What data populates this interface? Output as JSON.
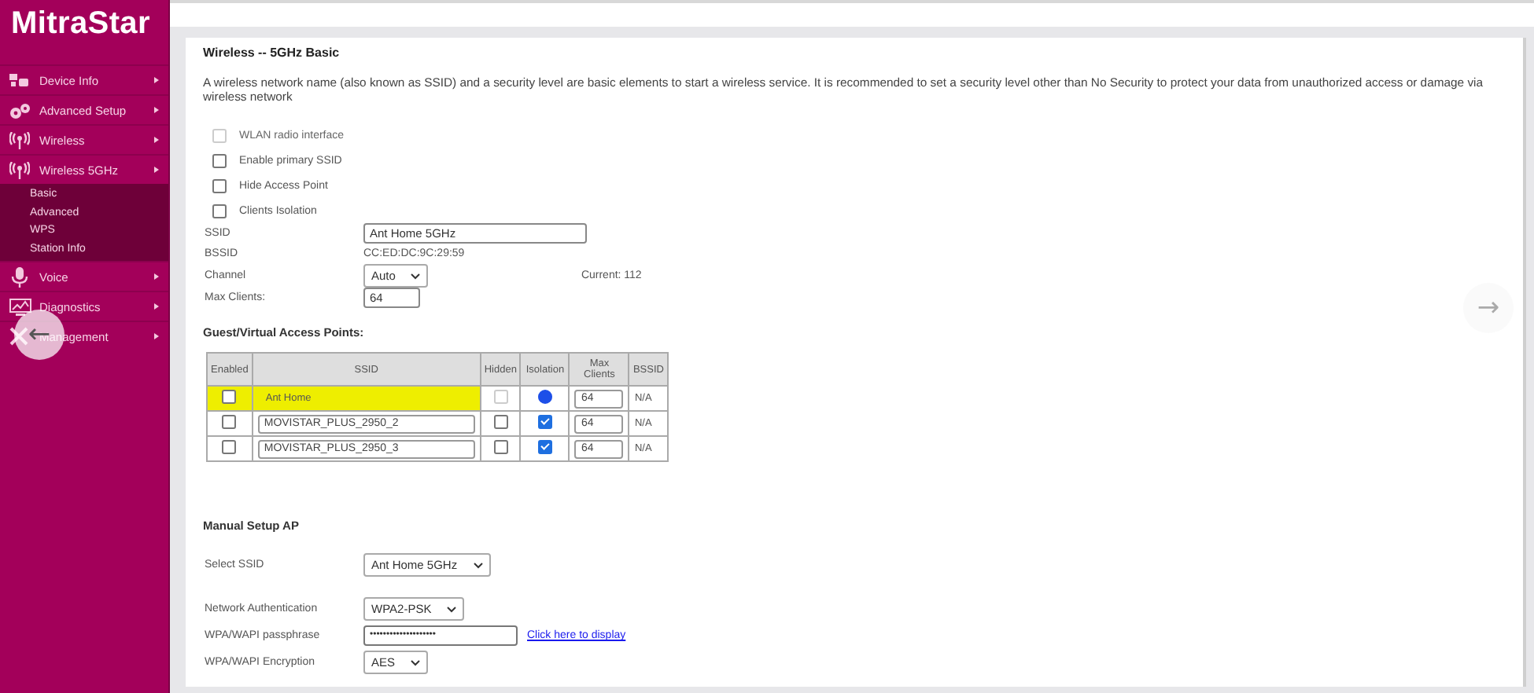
{
  "logo": "MitraStar",
  "sidebar": {
    "items": [
      {
        "label": "Device Info"
      },
      {
        "label": "Advanced Setup"
      },
      {
        "label": "Wireless"
      },
      {
        "label": "Wireless 5GHz",
        "children": [
          {
            "label": "Basic"
          },
          {
            "label": "Advanced"
          },
          {
            "label": "WPS"
          },
          {
            "label": "Station Info"
          }
        ]
      },
      {
        "label": "Voice"
      },
      {
        "label": "Diagnostics"
      },
      {
        "label": "Management"
      }
    ]
  },
  "page": {
    "title": "Wireless -- 5GHz Basic",
    "description": "A wireless network name (also known as SSID) and a security level are basic elements to start a wireless service. It is recommended to set a security level other than No Security to protect your data from unauthorized access or damage via wireless network",
    "options": [
      {
        "label": "WLAN radio interface",
        "checked": false,
        "disabled": true
      },
      {
        "label": "Enable primary SSID",
        "checked": false,
        "disabled": false
      },
      {
        "label": "Hide Access Point",
        "checked": false,
        "disabled": false
      },
      {
        "label": "Clients Isolation",
        "checked": false,
        "disabled": false
      }
    ],
    "fields": [
      {
        "label": "SSID",
        "kind": "input",
        "value": "Ant Home 5GHz"
      },
      {
        "label": "BSSID",
        "kind": "text",
        "value": "CC:ED:DC:9C:29:59"
      },
      {
        "label": "Channel",
        "kind": "select",
        "value": "Auto",
        "note": "Current: 112"
      },
      {
        "label": "Max Clients:",
        "kind": "small-input",
        "value": "64"
      }
    ]
  },
  "guest_access_points": {
    "title": "Guest/Virtual Access Points:",
    "columns": [
      "Enabled",
      "SSID",
      "Hidden",
      "Isolation",
      "Max Clients",
      "BSSID"
    ],
    "rows": [
      {
        "enabled": false,
        "ssid": "Ant Home",
        "hidden": false,
        "hidden_disabled": true,
        "isolation": true,
        "max_clients": "64",
        "bssid": "N/A",
        "highlighted": true
      },
      {
        "enabled": false,
        "ssid": "MOVISTAR_PLUS_2950_2",
        "hidden": false,
        "hidden_disabled": false,
        "isolation": true,
        "max_clients": "64",
        "bssid": "N/A",
        "highlighted": false
      },
      {
        "enabled": false,
        "ssid": "MOVISTAR_PLUS_2950_3",
        "hidden": false,
        "hidden_disabled": false,
        "isolation": true,
        "max_clients": "64",
        "bssid": "N/A",
        "highlighted": false
      }
    ]
  },
  "manual_setup": {
    "title": "Manual Setup AP",
    "fields": [
      {
        "label": "Select SSID",
        "kind": "select",
        "value": "Ant Home 5GHz"
      },
      {
        "label": "Network Authentication",
        "kind": "select",
        "value": "WPA2-PSK"
      },
      {
        "label": "WPA/WAPI passphrase",
        "kind": "password",
        "value": "••••••••••••••••••••",
        "link": "Click here to display"
      },
      {
        "label": "WPA/WAPI Encryption",
        "kind": "select",
        "value": "AES"
      }
    ]
  },
  "nav": {
    "back": "←",
    "forward": "→"
  }
}
